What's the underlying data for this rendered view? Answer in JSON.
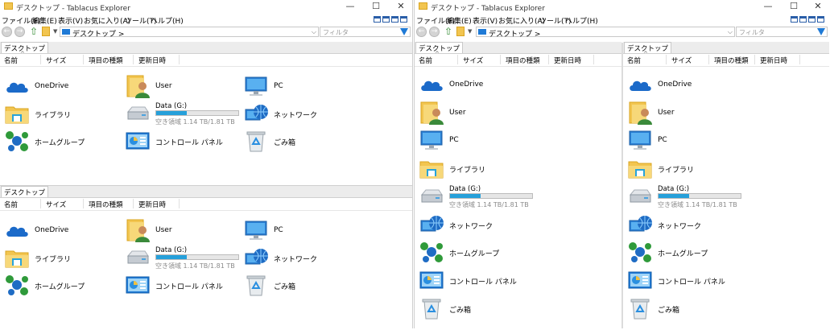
{
  "app_title": "デスクトップ - Tablacus Explorer",
  "window_buttons": {
    "minimize": "—",
    "maximize": "☐",
    "close": "✕"
  },
  "menu": [
    "ファイル(F)",
    "編集(E)",
    "表示(V)",
    "お気に入り(A)",
    "ツール(T)",
    "ヘルプ(H)"
  ],
  "address": "デスクトップ >",
  "filter_placeholder": "フィルタ",
  "tab_label": "デスクトップ",
  "columns": [
    "名前",
    "サイズ",
    "項目の種類",
    "更新日時"
  ],
  "items": {
    "onedrive": "OneDrive",
    "user": "User",
    "pc": "PC",
    "library": "ライブラリ",
    "drive_name": "Data (G:)",
    "drive_free": "空き領域 1.14 TB/1.81 TB",
    "drive_used_fraction": 0.37,
    "network": "ネットワーク",
    "homegroup": "ホームグループ",
    "control_panel": "コントロール パネル",
    "recycle_bin": "ごみ箱"
  }
}
